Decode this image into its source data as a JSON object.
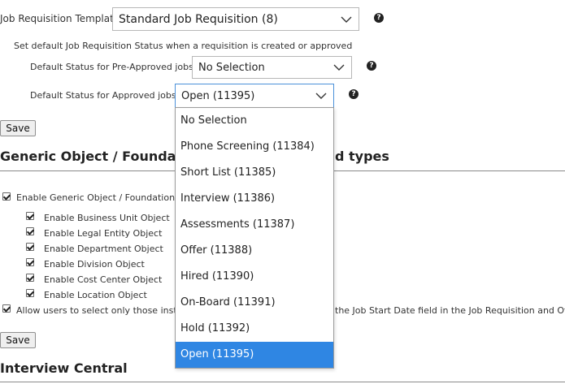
{
  "template": {
    "label": "Job Requisition Template",
    "value": "Standard Job Requisition (8)"
  },
  "status_note": "Set default Job Requisition Status when a requisition is created or approved",
  "pre_approved": {
    "label": "Default Status for Pre-Approved jobs",
    "value": "No Selection"
  },
  "approved": {
    "label": "Default Status for Approved jobs",
    "value": "Open (11395)"
  },
  "buttons": {
    "save": "Save"
  },
  "generic_section": {
    "title": "Generic Object / Foundation Object field types",
    "title_visible_left": "Generic Object / Foundati",
    "title_visible_right": "d types",
    "enable_main": "Enable Generic Object / Foundation O",
    "items": [
      "Enable Business Unit Object",
      "Enable Legal Entity Object",
      "Enable Department Object",
      "Enable Division Object",
      "Enable Cost Center Object",
      "Enable Location Object"
    ],
    "allow_left": "Allow users to select only those insta",
    "allow_right": "the Job Start Date field in the Job Requisition and Offe"
  },
  "interview_section": {
    "title": "Interview Central"
  },
  "dropdown_options": [
    "No Selection",
    "Phone Screening (11384)",
    "Short List (11385)",
    "Interview (11386)",
    "Assessments (11387)",
    "Offer (11388)",
    "Hired (11390)",
    "On-Board (11391)",
    "Hold (11392)",
    "Open (11395)"
  ],
  "selected_option": "Open (11395)",
  "colors": {
    "selected_bg": "#2f86e3",
    "focus_border": "#4a90d9"
  }
}
